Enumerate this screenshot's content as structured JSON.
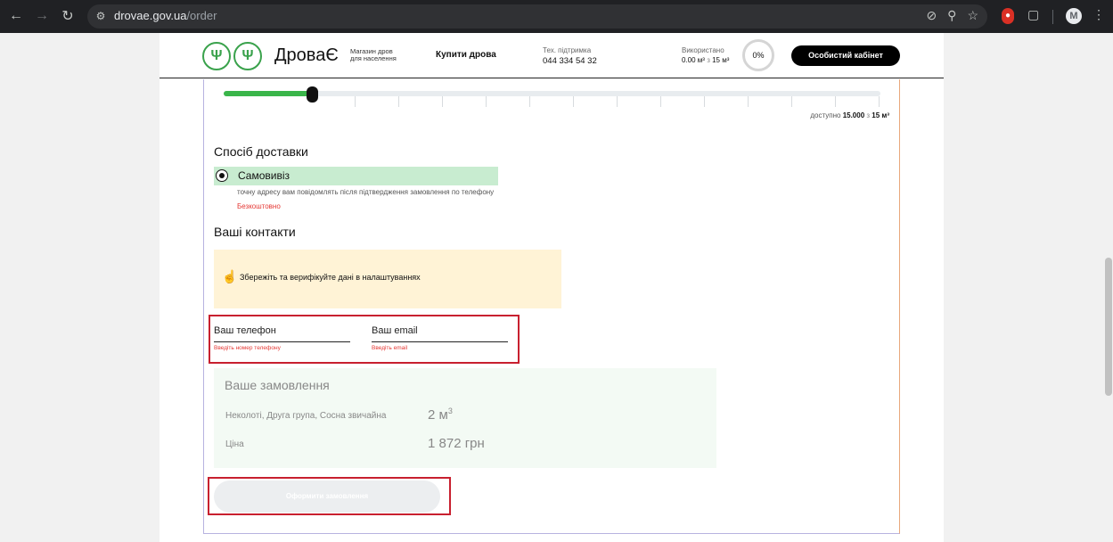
{
  "browser": {
    "url_host": "drovae.gov.ua",
    "url_path": "/order",
    "avatar_letter": "M"
  },
  "header": {
    "brand": "ДроваЄ",
    "tagline": "Магазин дров для населення",
    "buy_link": "Купити дрова",
    "support_label": "Тех. підтримка",
    "support_phone": "044 334 54 32",
    "used_label": "Використано",
    "used_amount": "0.00 м³",
    "used_of": "з",
    "used_total": "15 м³",
    "used_percent": "0%",
    "cabinet_button": "Особистий кабінет"
  },
  "volume_slider": {
    "level_fraction": 0.135,
    "available_label": "доступно",
    "available_value": "15.000",
    "available_of": "з",
    "available_total": "15 м³"
  },
  "delivery": {
    "title": "Спосіб доставки",
    "option_label": "Самовивіз",
    "option_selected": true,
    "option_note": "точну адресу вам повідомлять після підтвердження замовлення по телефону",
    "option_price": "Безкоштовно"
  },
  "contacts": {
    "title": "Ваші контакти",
    "notice_icon": "pointing-hand-icon",
    "notice_text": "Збережіть та верифікуйте дані в налаштуваннях",
    "phone_label": "Ваш телефон",
    "phone_error": "Введіть номер телефону",
    "email_label": "Ваш email",
    "email_error": "Введіть email"
  },
  "order": {
    "title": "Ваше замовлення",
    "item": "Неколоті, Друга група, Сосна звичайна",
    "qty_value": "2 м",
    "qty_exp": "3",
    "price_label": "Ціна",
    "price_value": "1 872 грн",
    "submit_button": "Оформити замовлення"
  },
  "colors": {
    "accent_green": "#3ab54a",
    "error_red": "#e53935",
    "highlight_red": "#c8202f"
  }
}
